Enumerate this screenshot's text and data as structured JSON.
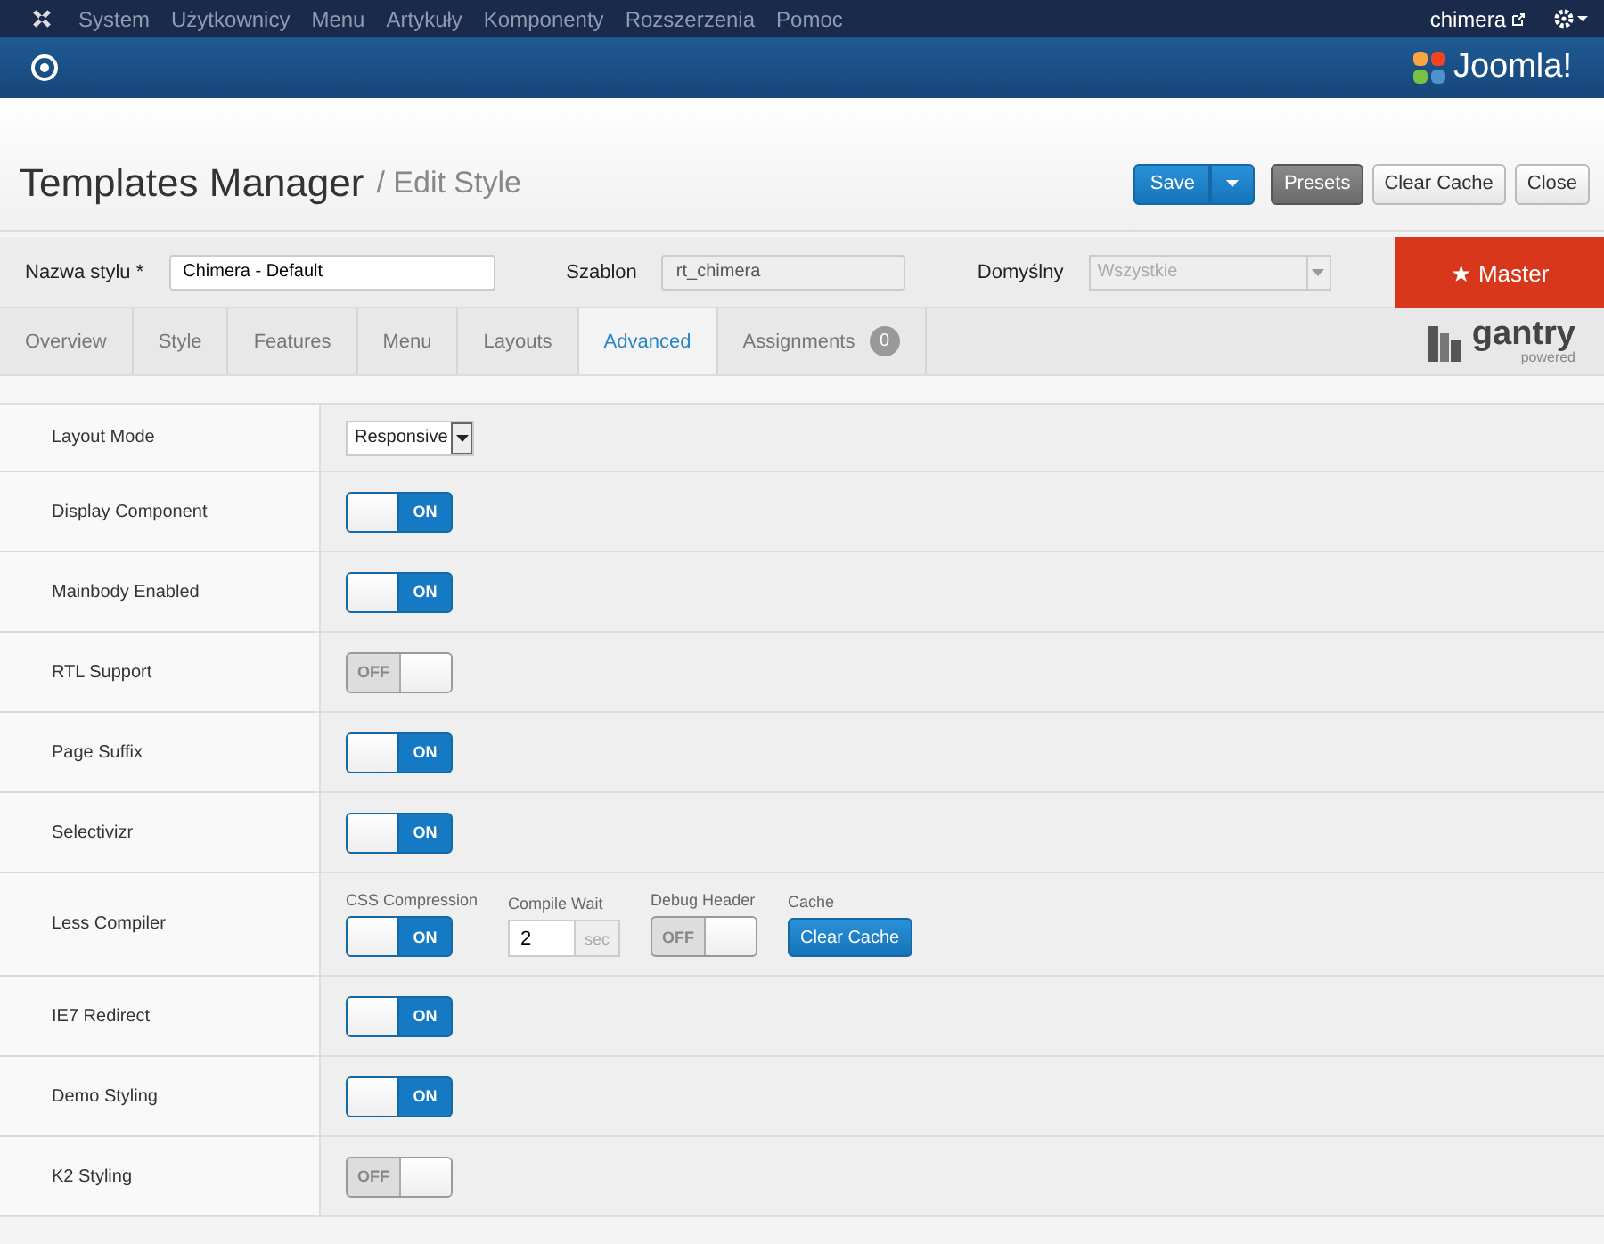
{
  "top_menu": {
    "items": [
      "System",
      "Użytkownicy",
      "Menu",
      "Artykuły",
      "Komponenty",
      "Rozszerzenia",
      "Pomoc"
    ],
    "user": "chimera"
  },
  "brand": {
    "name": "Joomla!"
  },
  "header": {
    "title": "Templates Manager",
    "subtitle": "/ Edit Style",
    "buttons": [
      {
        "label": "Save",
        "kind": "split"
      },
      {
        "label": "Presets",
        "kind": "dark"
      },
      {
        "label": "Clear Cache",
        "kind": "plain"
      },
      {
        "label": "Close",
        "kind": "plain"
      }
    ]
  },
  "form": {
    "style_label": "Nazwa stylu *",
    "style_value": "Chimera - Default",
    "template_label": "Szablon",
    "template_value": "rt_chimera",
    "default_label": "Domyślny",
    "default_value": "Wszystkie",
    "master": "★ Master"
  },
  "tabs": [
    {
      "label": "Overview",
      "selected": false
    },
    {
      "label": "Style",
      "selected": false
    },
    {
      "label": "Features",
      "selected": false
    },
    {
      "label": "Menu",
      "selected": false
    },
    {
      "label": "Layouts",
      "selected": false
    },
    {
      "label": "Advanced",
      "selected": true
    },
    {
      "label": "Assignments",
      "selected": false,
      "badge": "0"
    }
  ],
  "gantry": {
    "name": "gantry",
    "sub": "powered"
  },
  "rows": [
    {
      "label": "Layout Mode",
      "kind": "select",
      "value": "Responsive"
    },
    {
      "label": "Display Component",
      "kind": "toggle",
      "on": true,
      "state_label": "ON"
    },
    {
      "label": "Mainbody Enabled",
      "kind": "toggle",
      "on": true,
      "state_label": "ON"
    },
    {
      "label": "RTL Support",
      "kind": "toggle",
      "on": false,
      "state_label": "OFF"
    },
    {
      "label": "Page Suffix",
      "kind": "toggle",
      "on": true,
      "state_label": "ON"
    },
    {
      "label": "Selectivizr",
      "kind": "toggle",
      "on": true,
      "state_label": "ON"
    },
    {
      "label": "Less Compiler",
      "kind": "group",
      "fields": [
        {
          "label": "CSS Compression",
          "kind": "toggle",
          "on": true,
          "state_label": "ON"
        },
        {
          "label": "Compile Wait",
          "kind": "number",
          "value": "2",
          "unit": "sec"
        },
        {
          "label": "Debug Header",
          "kind": "toggle",
          "on": false,
          "state_label": "OFF"
        },
        {
          "label": "Cache",
          "kind": "button",
          "value": "Clear Cache"
        }
      ]
    },
    {
      "label": "IE7 Redirect",
      "kind": "toggle",
      "on": true,
      "state_label": "ON"
    },
    {
      "label": "Demo Styling",
      "kind": "toggle",
      "on": true,
      "state_label": "ON"
    },
    {
      "label": "K2 Styling",
      "kind": "toggle",
      "on": false,
      "state_label": "OFF"
    }
  ]
}
